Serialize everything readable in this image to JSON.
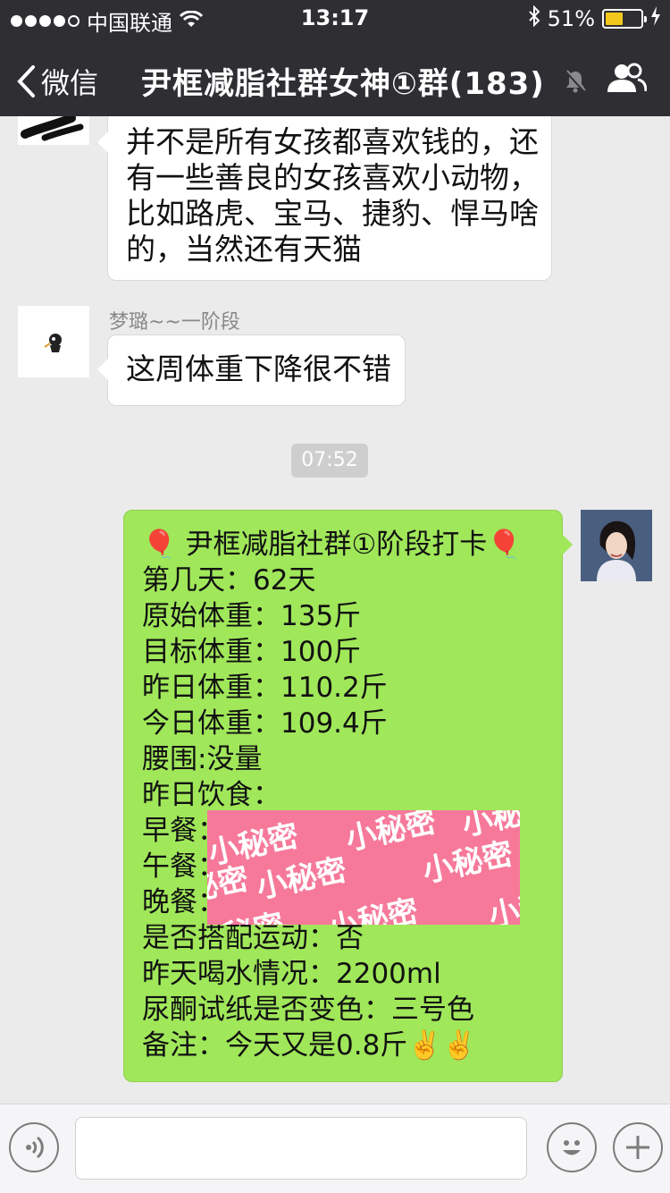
{
  "status_bar": {
    "carrier": "中国联通",
    "time": "13:17",
    "battery_percent": "51%",
    "battery_level": 0.51,
    "signal_bars_filled": 4
  },
  "nav": {
    "back_label": "微信",
    "title": "尹框减脂社群女神①群(183)"
  },
  "messages": {
    "m1": {
      "lines": [
        "并不是所有女孩都喜欢钱的，还",
        "有一些善良的女孩喜欢小动物，",
        "比如路虎、宝马、捷豹、悍马啥",
        "的，当然还有天猫"
      ]
    },
    "m2": {
      "sender": "梦璐~~一阶段",
      "text": "这周体重下降很不错"
    },
    "timestamp": "07:52",
    "m3": {
      "lines": [
        "🎈 尹框减脂社群①阶段打卡🎈",
        "第几天：62天",
        "原始体重：135斤",
        "目标体重：100斤",
        "昨日体重：110.2斤",
        "今日体重：109.4斤",
        "腰围:没量",
        "昨日饮食：",
        "早餐：",
        "午餐：",
        "晚餐：",
        "是否搭配运动：否",
        "昨天喝水情况：2200ml",
        "尿酮试纸是否变色：三号色",
        "备注：今天又是0.8斤✌️✌️"
      ],
      "censor_text": "小秘密"
    }
  },
  "colors": {
    "nav_bg": "#2e2e33",
    "chat_bg": "#ebebeb",
    "bubble_green": "#a0e75a",
    "censor_pink": "#f6799a"
  }
}
